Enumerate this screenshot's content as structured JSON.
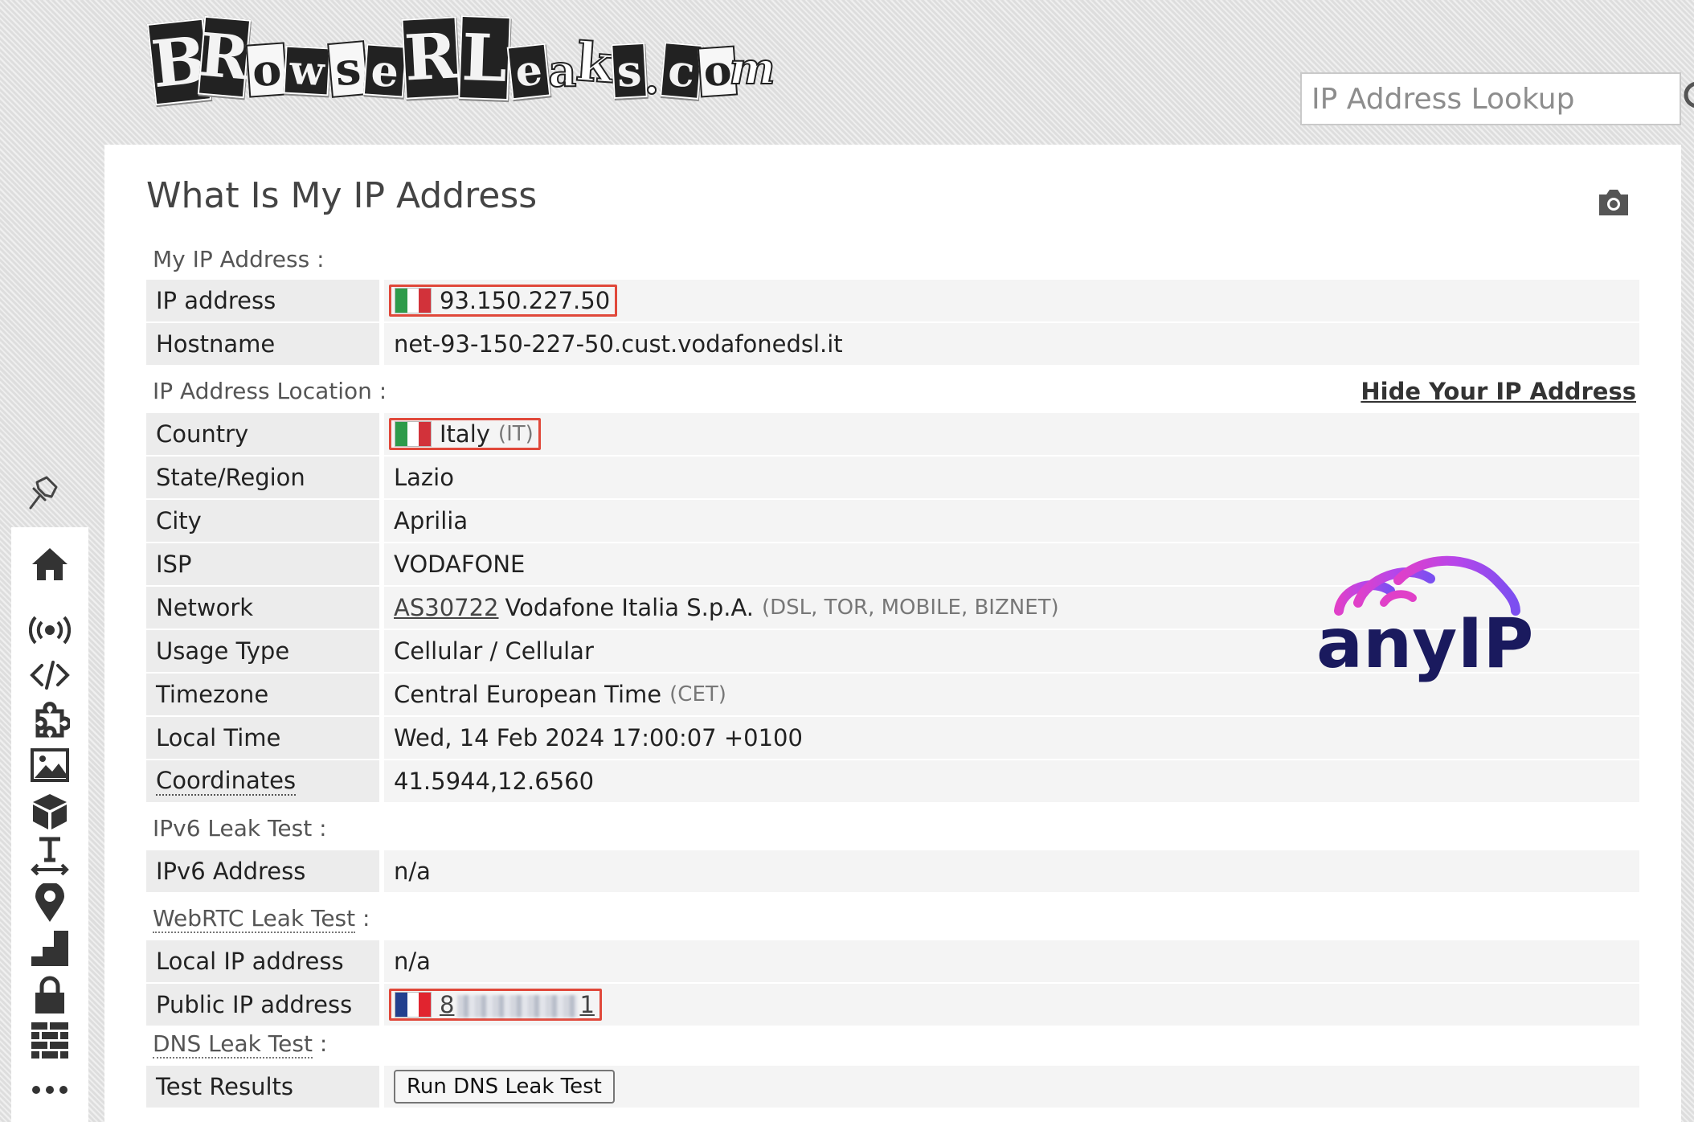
{
  "logo": {
    "text": "BrowserLeaks.com",
    "tiles": [
      "B",
      "R",
      "o",
      "w",
      "s",
      "e",
      "R",
      "L",
      "e",
      "a",
      "k",
      "s",
      ".",
      "c",
      "o",
      "m"
    ]
  },
  "search": {
    "placeholder": "IP Address Lookup",
    "icon": "search-icon"
  },
  "page_title": "What Is My IP Address",
  "sections": {
    "my_ip": "My IP Address :",
    "location": "IP Address Location :",
    "ipv6": "IPv6 Leak Test :",
    "webrtc": "WebRTC Leak Test",
    "dns": "DNS Leak Test",
    "colon": " :"
  },
  "hide_ip_link": "Hide Your IP Address",
  "rows": {
    "ip_address": {
      "label": "IP address",
      "value": "93.150.227.50"
    },
    "hostname": {
      "label": "Hostname",
      "value": "net-93-150-227-50.cust.vodafonedsl.it"
    },
    "country": {
      "label": "Country",
      "value": "Italy",
      "code": "(IT)"
    },
    "state": {
      "label": "State/Region",
      "value": "Lazio"
    },
    "city": {
      "label": "City",
      "value": "Aprilia"
    },
    "isp": {
      "label": "ISP",
      "value": "VODAFONE"
    },
    "network": {
      "label": "Network",
      "asn": "AS30722",
      "value": "Vodafone Italia S.p.A.",
      "tags": "(DSL, TOR, MOBILE, BIZNET)"
    },
    "usage": {
      "label": "Usage Type",
      "value": "Cellular / Cellular"
    },
    "timezone": {
      "label": "Timezone",
      "value": "Central European Time",
      "abbr": "(CET)"
    },
    "local_time": {
      "label": "Local Time",
      "value": "Wed, 14 Feb 2024 17:00:07 +0100"
    },
    "coordinates": {
      "label": "Coordinates",
      "value": "41.5944,12.6560"
    },
    "ipv6_address": {
      "label": "IPv6 Address",
      "value": "n/a"
    },
    "local_ip": {
      "label": "Local IP address",
      "value": "n/a"
    },
    "public_ip": {
      "label": "Public IP address",
      "value_start": "8",
      "value_end": "1"
    },
    "dns": {
      "label": "Test Results",
      "button": "Run DNS Leak Test"
    }
  },
  "flags": {
    "italy": [
      "#2e9b4a",
      "#ffffff",
      "#d2323a"
    ],
    "france": [
      "#23408e",
      "#ffffff",
      "#e1242f"
    ]
  },
  "watermark": {
    "text": "anyIP",
    "text_color": "#1a1a5e",
    "arc_colors": [
      "#e040c8",
      "#b646ea",
      "#7b4ff0"
    ]
  },
  "sidebar_icons": [
    "pin-icon",
    "home-icon",
    "broadcast-icon",
    "code-icon",
    "puzzle-icon",
    "image-icon",
    "cube-icon",
    "text-size-icon",
    "location-pin-icon",
    "stairs-icon",
    "lock-icon",
    "firewall-icon",
    "more-icon"
  ]
}
